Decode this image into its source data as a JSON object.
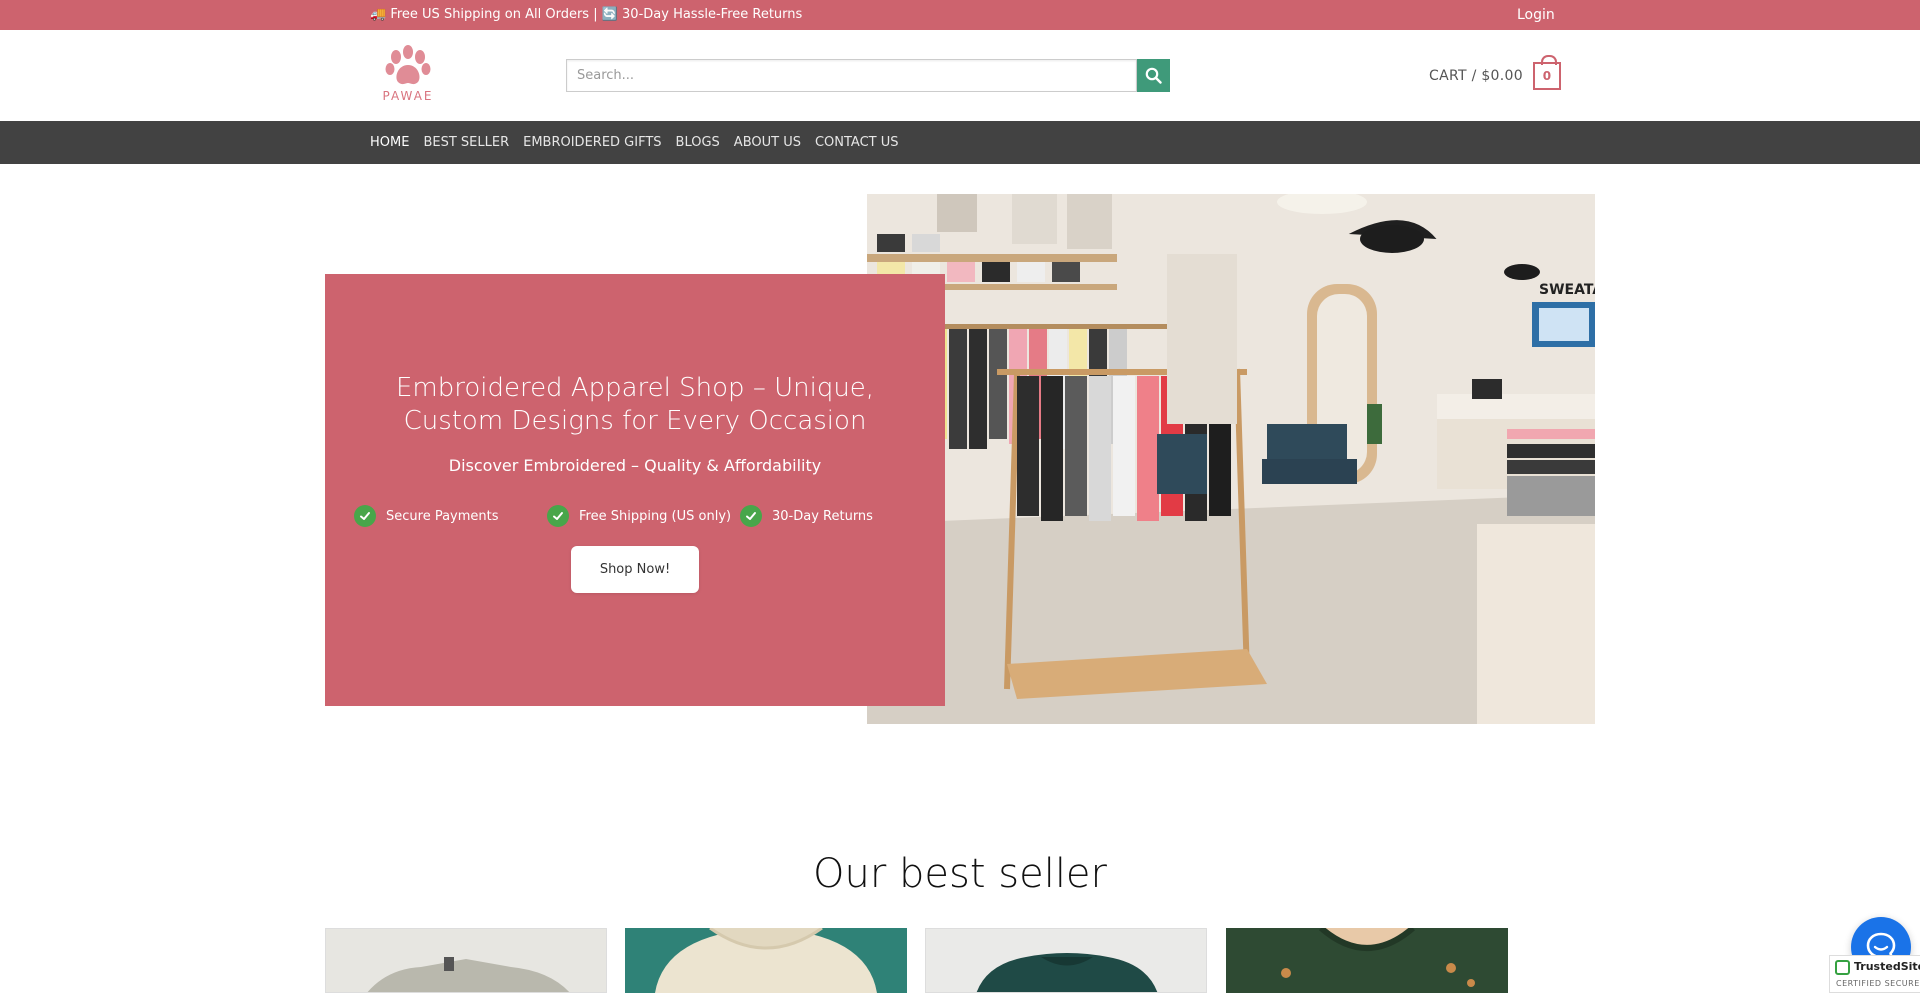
{
  "topbar": {
    "promo": "🚚 Free US Shipping on All Orders | 🔄 30-Day Hassle-Free Returns",
    "login": "Login"
  },
  "header": {
    "logo_text": "PAWAE",
    "search_placeholder": "Search...",
    "cart_label": "CART / $0.00",
    "cart_count": "0"
  },
  "nav": {
    "items": [
      "HOME",
      "BEST SELLER",
      "EMBROIDERED GIFTS",
      "BLOGS",
      "ABOUT US",
      "CONTACT US"
    ]
  },
  "hero": {
    "title": "Embroidered Apparel Shop – Unique, Custom Designs for Every Occasion",
    "subtitle": "Discover Embroidered – Quality & Affordability",
    "features": [
      "Secure Payments",
      "Free Shipping (US only)",
      "30-Day Returns"
    ],
    "button": "Shop Now!",
    "store_sign": "SWEATA"
  },
  "best_seller": {
    "title": "Our best seller"
  },
  "trust_badge": {
    "name": "TrustedSite",
    "sub": "CERTIFIED SECURE"
  },
  "colors": {
    "brand": "#cd636e",
    "nav": "#424242",
    "search_button": "#3f9a7a",
    "chat": "#1a73e8"
  },
  "icons": [
    "paw-icon",
    "search-icon",
    "check-icon",
    "chat-icon",
    "trust-check-icon"
  ]
}
